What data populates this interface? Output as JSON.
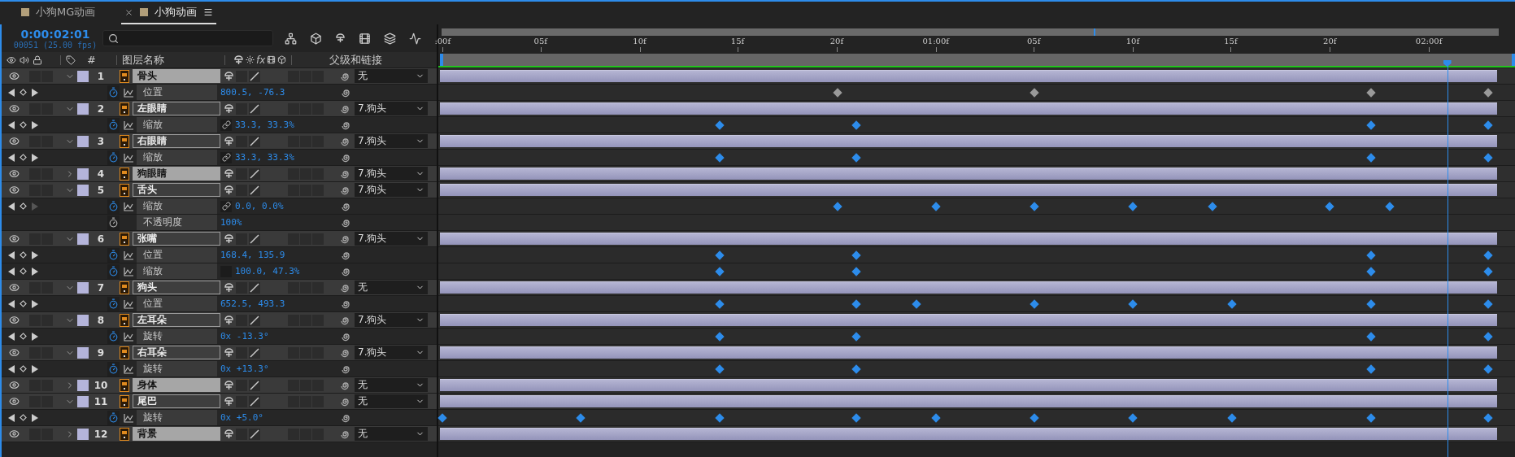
{
  "tabs": [
    {
      "label": "小狗MG动画",
      "selected": false,
      "closable": false
    },
    {
      "label": "小狗动画",
      "selected": true,
      "closable": true
    }
  ],
  "timecode": "0:00:02:01",
  "frame_info": "00051 (25.00 fps)",
  "columns": {
    "number": "#",
    "layer_name": "图层名称",
    "effects": "fx",
    "parent": "父级和链接"
  },
  "ruler": {
    "navigator": {
      "level": 0.617
    },
    "playhead": {
      "level": 0.937
    },
    "ticks": [
      {
        "label": ":00f",
        "level": 0.004
      },
      {
        "label": "05f",
        "level": 0.095
      },
      {
        "label": "10f",
        "level": 0.187
      },
      {
        "label": "15f",
        "level": 0.278
      },
      {
        "label": "20f",
        "level": 0.37
      },
      {
        "label": "01:00f",
        "level": 0.462
      },
      {
        "label": "05f",
        "level": 0.553
      },
      {
        "label": "10f",
        "level": 0.645
      },
      {
        "label": "15f",
        "level": 0.736
      },
      {
        "label": "20f",
        "level": 0.828
      },
      {
        "label": "02:00f",
        "level": 0.92
      }
    ]
  },
  "layers": [
    {
      "number": "1",
      "name": "骨头",
      "expanded": true,
      "highlighted": true,
      "parent": "无",
      "bar": {
        "level": 0.982
      },
      "properties": [
        {
          "kind": "position",
          "name": "位置",
          "value": "800.5, -76.3",
          "stopwatch": true,
          "has_next": true,
          "keyframes": [
            {
              "level": 0.371,
              "selected": false
            },
            {
              "level": 0.554,
              "selected": false
            },
            {
              "level": 0.866,
              "selected": false
            },
            {
              "level": 0.975,
              "selected": false
            }
          ]
        }
      ]
    },
    {
      "number": "2",
      "name": "左眼睛",
      "expanded": true,
      "highlighted": false,
      "parent": "7.狗头",
      "bar": {
        "level": 0.982
      },
      "properties": [
        {
          "kind": "scale",
          "name": "缩放",
          "value": "33.3, 33.3%",
          "linked": true,
          "stopwatch": true,
          "has_next": true,
          "keyframes": [
            {
              "level": 0.261,
              "selected": true
            },
            {
              "level": 0.388,
              "selected": true
            },
            {
              "level": 0.866,
              "selected": true
            },
            {
              "level": 0.975,
              "selected": true
            }
          ]
        }
      ]
    },
    {
      "number": "3",
      "name": "右眼睛",
      "expanded": true,
      "highlighted": false,
      "parent": "7.狗头",
      "bar": {
        "level": 0.982
      },
      "properties": [
        {
          "kind": "scale",
          "name": "缩放",
          "value": "33.3, 33.3%",
          "linked": true,
          "stopwatch": true,
          "has_next": true,
          "keyframes": [
            {
              "level": 0.261,
              "selected": true
            },
            {
              "level": 0.388,
              "selected": true
            },
            {
              "level": 0.866,
              "selected": true
            },
            {
              "level": 0.975,
              "selected": true
            }
          ]
        }
      ]
    },
    {
      "number": "4",
      "name": "狗眼睛",
      "expanded": false,
      "highlighted": true,
      "parent": "7.狗头",
      "bar": {
        "level": 0.982
      }
    },
    {
      "number": "5",
      "name": "舌头",
      "expanded": true,
      "highlighted": false,
      "parent": "7.狗头",
      "bar": {
        "level": 0.982
      },
      "properties": [
        {
          "kind": "scale",
          "name": "缩放",
          "value": "0.0, 0.0%",
          "linked": true,
          "stopwatch": true,
          "has_next": false,
          "keyframes": [
            {
              "level": 0.371,
              "selected": true
            },
            {
              "level": 0.462,
              "selected": true
            },
            {
              "level": 0.554,
              "selected": true
            },
            {
              "level": 0.645,
              "selected": true
            },
            {
              "level": 0.719,
              "selected": true
            },
            {
              "level": 0.828,
              "selected": true
            },
            {
              "level": 0.884,
              "selected": true
            }
          ]
        },
        {
          "kind": "opacity",
          "name": "不透明度",
          "value": "100%",
          "stopwatch": false
        }
      ]
    },
    {
      "number": "6",
      "name": "张嘴",
      "expanded": true,
      "highlighted": false,
      "parent": "7.狗头",
      "bar": {
        "level": 0.982
      },
      "properties": [
        {
          "kind": "position",
          "name": "位置",
          "value": "168.4, 135.9",
          "stopwatch": true,
          "has_next": true,
          "keyframes": [
            {
              "level": 0.261,
              "selected": true
            },
            {
              "level": 0.388,
              "selected": true
            },
            {
              "level": 0.866,
              "selected": true
            },
            {
              "level": 0.975,
              "selected": true
            }
          ]
        },
        {
          "kind": "scale",
          "name": "缩放",
          "value": "100.0, 47.3%",
          "linked": false,
          "stopwatch": true,
          "has_next": true,
          "keyframes": [
            {
              "level": 0.261,
              "selected": true
            },
            {
              "level": 0.388,
              "selected": true
            },
            {
              "level": 0.866,
              "selected": true
            },
            {
              "level": 0.975,
              "selected": true
            }
          ]
        }
      ]
    },
    {
      "number": "7",
      "name": "狗头",
      "expanded": true,
      "highlighted": false,
      "parent": "无",
      "bar": {
        "level": 0.982
      },
      "properties": [
        {
          "kind": "position",
          "name": "位置",
          "value": "652.5, 493.3",
          "stopwatch": true,
          "has_next": true,
          "keyframes": [
            {
              "level": 0.261,
              "selected": true
            },
            {
              "level": 0.388,
              "selected": true
            },
            {
              "level": 0.444,
              "selected": true
            },
            {
              "level": 0.554,
              "selected": true
            },
            {
              "level": 0.645,
              "selected": true
            },
            {
              "level": 0.737,
              "selected": true
            },
            {
              "level": 0.866,
              "selected": true
            },
            {
              "level": 0.975,
              "selected": true
            }
          ]
        }
      ]
    },
    {
      "number": "8",
      "name": "左耳朵",
      "expanded": true,
      "highlighted": false,
      "parent": "7.狗头",
      "bar": {
        "level": 0.982
      },
      "properties": [
        {
          "kind": "rotation",
          "name": "旋转",
          "value": "0x -13.3°",
          "stopwatch": true,
          "has_next": true,
          "keyframes": [
            {
              "level": 0.261,
              "selected": true
            },
            {
              "level": 0.388,
              "selected": true
            },
            {
              "level": 0.866,
              "selected": true
            },
            {
              "level": 0.975,
              "selected": true
            }
          ]
        }
      ]
    },
    {
      "number": "9",
      "name": "右耳朵",
      "expanded": true,
      "highlighted": false,
      "parent": "7.狗头",
      "bar": {
        "level": 0.982
      },
      "properties": [
        {
          "kind": "rotation",
          "name": "旋转",
          "value": "0x +13.3°",
          "stopwatch": true,
          "has_next": true,
          "keyframes": [
            {
              "level": 0.261,
              "selected": true
            },
            {
              "level": 0.388,
              "selected": true
            },
            {
              "level": 0.866,
              "selected": true
            },
            {
              "level": 0.975,
              "selected": true
            }
          ]
        }
      ]
    },
    {
      "number": "10",
      "name": "身体",
      "expanded": false,
      "highlighted": true,
      "parent": "无",
      "bar": {
        "level": 0.982
      }
    },
    {
      "number": "11",
      "name": "尾巴",
      "expanded": true,
      "highlighted": false,
      "parent": "无",
      "bar": {
        "level": 0.982
      },
      "properties": [
        {
          "kind": "rotation",
          "name": "旋转",
          "value": "0x +5.0°",
          "stopwatch": true,
          "has_next": true,
          "keyframes": [
            {
              "level": 0.004,
              "selected": true
            },
            {
              "level": 0.132,
              "selected": true
            },
            {
              "level": 0.261,
              "selected": true
            },
            {
              "level": 0.388,
              "selected": true
            },
            {
              "level": 0.462,
              "selected": true
            },
            {
              "level": 0.554,
              "selected": true
            },
            {
              "level": 0.645,
              "selected": true
            },
            {
              "level": 0.737,
              "selected": true
            },
            {
              "level": 0.866,
              "selected": true
            },
            {
              "level": 0.975,
              "selected": true
            }
          ]
        }
      ]
    },
    {
      "number": "12",
      "name": "背景",
      "expanded": false,
      "highlighted": true,
      "parent": "无",
      "bar": {
        "level": 0.982
      }
    }
  ]
}
